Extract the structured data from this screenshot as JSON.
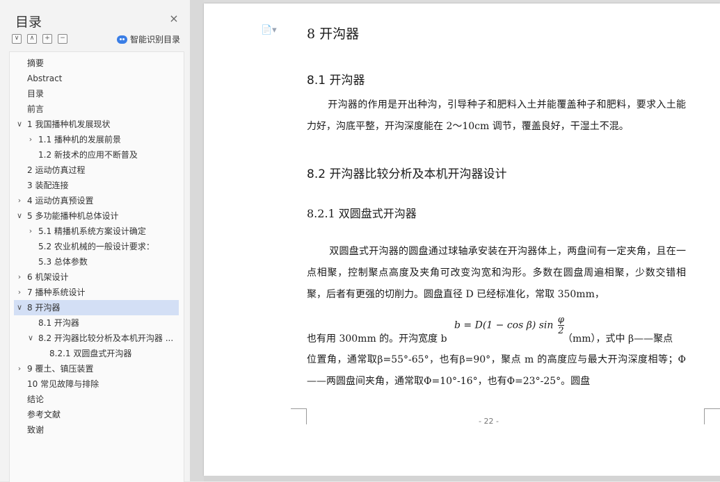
{
  "sidebar": {
    "title": "目录",
    "close_icon": "×",
    "tools": [
      "∨",
      "∧",
      "+",
      "−"
    ],
    "smart_label": "智能识别目录",
    "items": [
      {
        "label": "摘要",
        "level": 0,
        "chev": ""
      },
      {
        "label": "Abstract",
        "level": 0,
        "chev": ""
      },
      {
        "label": "目录",
        "level": 0,
        "chev": ""
      },
      {
        "label": "前言",
        "level": 0,
        "chev": ""
      },
      {
        "label": "1 我国播种机发展现状",
        "level": 0,
        "chev": "∨"
      },
      {
        "label": "1.1 播种机的发展前景",
        "level": 1,
        "chev": "›"
      },
      {
        "label": "1.2 新技术的应用不断普及",
        "level": 1,
        "chev": ""
      },
      {
        "label": "2 运动仿真过程",
        "level": 0,
        "chev": ""
      },
      {
        "label": "3 装配连接",
        "level": 0,
        "chev": ""
      },
      {
        "label": "4  运动仿真预设置",
        "level": 0,
        "chev": "›"
      },
      {
        "label": "5 多功能播种机总体设计",
        "level": 0,
        "chev": "∨"
      },
      {
        "label": "5.1 精播机系统方案设计确定",
        "level": 1,
        "chev": "›"
      },
      {
        "label": "5.2 农业机械的一般设计要求：",
        "level": 1,
        "chev": ""
      },
      {
        "label": "5.3 总体参数",
        "level": 1,
        "chev": ""
      },
      {
        "label": "6 机架设计",
        "level": 0,
        "chev": "›"
      },
      {
        "label": "7 播种系统设计",
        "level": 0,
        "chev": "›"
      },
      {
        "label": "8 开沟器",
        "level": 0,
        "chev": "∨",
        "active": true
      },
      {
        "label": "8.1 开沟器",
        "level": 1,
        "chev": ""
      },
      {
        "label": "8.2 开沟器比较分析及本机开沟器 ...",
        "level": 1,
        "chev": "∨"
      },
      {
        "label": "8.2.1 双圆盘式开沟器",
        "level": 2,
        "chev": ""
      },
      {
        "label": "9 覆土、镇压装置",
        "level": 0,
        "chev": "›"
      },
      {
        "label": "10  常见故障与排除",
        "level": 0,
        "chev": ""
      },
      {
        "label": "结论",
        "level": 0,
        "chev": ""
      },
      {
        "label": "参考文献",
        "level": 0,
        "chev": ""
      },
      {
        "label": "致谢",
        "level": 0,
        "chev": ""
      }
    ]
  },
  "doc": {
    "icon": "document-icon",
    "chapter_title": "8 开沟器",
    "sec1_title": "8.1 开沟器",
    "para1": "开沟器的作用是开出种沟，引导种子和肥料入土并能覆盖种子和肥料，要求入土能力好，沟底平整，开沟深度能在 2～10cm 调节，覆盖良好，干湿土不混。",
    "sec2_title": "8.2 开沟器比较分析及本机开沟器设计",
    "sub_title": "8.2.1 双圆盘式开沟器",
    "para2": "双圆盘式开沟器的圆盘通过球轴承安装在开沟器体上，两盘间有一定夹角，且在一点相聚，控制聚点高度及夹角可改变沟宽和沟形。多数在圆盘周遍相聚，少数交错相聚，后者有更强的切削力。圆盘直径 D 已经标准化，常取 350mm，",
    "formula_prefix": "也有用 300mm 的。开沟宽度 b",
    "formula_main": "b = D(1 − cos β) sin",
    "formula_num": "φ",
    "formula_den": "2",
    "formula_suffix": "（mm），式中  β——聚点",
    "para3": "位置角，通常取β=55°-65°，也有β=90°，聚点 m 的高度应与最大开沟深度相等；Φ——两圆盘间夹角，通常取Φ=10°-16°，也有Φ=23°-25°。圆盘",
    "page_number": "- 22 -"
  }
}
